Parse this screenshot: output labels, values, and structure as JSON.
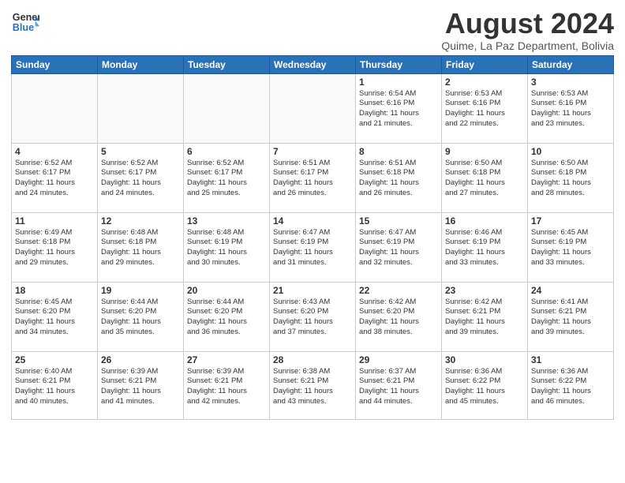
{
  "header": {
    "logo_general": "General",
    "logo_blue": "Blue",
    "month_title": "August 2024",
    "subtitle": "Quime, La Paz Department, Bolivia"
  },
  "days_of_week": [
    "Sunday",
    "Monday",
    "Tuesday",
    "Wednesday",
    "Thursday",
    "Friday",
    "Saturday"
  ],
  "weeks": [
    [
      {
        "num": "",
        "info": ""
      },
      {
        "num": "",
        "info": ""
      },
      {
        "num": "",
        "info": ""
      },
      {
        "num": "",
        "info": ""
      },
      {
        "num": "1",
        "info": "Sunrise: 6:54 AM\nSunset: 6:16 PM\nDaylight: 11 hours\nand 21 minutes."
      },
      {
        "num": "2",
        "info": "Sunrise: 6:53 AM\nSunset: 6:16 PM\nDaylight: 11 hours\nand 22 minutes."
      },
      {
        "num": "3",
        "info": "Sunrise: 6:53 AM\nSunset: 6:16 PM\nDaylight: 11 hours\nand 23 minutes."
      }
    ],
    [
      {
        "num": "4",
        "info": "Sunrise: 6:52 AM\nSunset: 6:17 PM\nDaylight: 11 hours\nand 24 minutes."
      },
      {
        "num": "5",
        "info": "Sunrise: 6:52 AM\nSunset: 6:17 PM\nDaylight: 11 hours\nand 24 minutes."
      },
      {
        "num": "6",
        "info": "Sunrise: 6:52 AM\nSunset: 6:17 PM\nDaylight: 11 hours\nand 25 minutes."
      },
      {
        "num": "7",
        "info": "Sunrise: 6:51 AM\nSunset: 6:17 PM\nDaylight: 11 hours\nand 26 minutes."
      },
      {
        "num": "8",
        "info": "Sunrise: 6:51 AM\nSunset: 6:18 PM\nDaylight: 11 hours\nand 26 minutes."
      },
      {
        "num": "9",
        "info": "Sunrise: 6:50 AM\nSunset: 6:18 PM\nDaylight: 11 hours\nand 27 minutes."
      },
      {
        "num": "10",
        "info": "Sunrise: 6:50 AM\nSunset: 6:18 PM\nDaylight: 11 hours\nand 28 minutes."
      }
    ],
    [
      {
        "num": "11",
        "info": "Sunrise: 6:49 AM\nSunset: 6:18 PM\nDaylight: 11 hours\nand 29 minutes."
      },
      {
        "num": "12",
        "info": "Sunrise: 6:48 AM\nSunset: 6:18 PM\nDaylight: 11 hours\nand 29 minutes."
      },
      {
        "num": "13",
        "info": "Sunrise: 6:48 AM\nSunset: 6:19 PM\nDaylight: 11 hours\nand 30 minutes."
      },
      {
        "num": "14",
        "info": "Sunrise: 6:47 AM\nSunset: 6:19 PM\nDaylight: 11 hours\nand 31 minutes."
      },
      {
        "num": "15",
        "info": "Sunrise: 6:47 AM\nSunset: 6:19 PM\nDaylight: 11 hours\nand 32 minutes."
      },
      {
        "num": "16",
        "info": "Sunrise: 6:46 AM\nSunset: 6:19 PM\nDaylight: 11 hours\nand 33 minutes."
      },
      {
        "num": "17",
        "info": "Sunrise: 6:45 AM\nSunset: 6:19 PM\nDaylight: 11 hours\nand 33 minutes."
      }
    ],
    [
      {
        "num": "18",
        "info": "Sunrise: 6:45 AM\nSunset: 6:20 PM\nDaylight: 11 hours\nand 34 minutes."
      },
      {
        "num": "19",
        "info": "Sunrise: 6:44 AM\nSunset: 6:20 PM\nDaylight: 11 hours\nand 35 minutes."
      },
      {
        "num": "20",
        "info": "Sunrise: 6:44 AM\nSunset: 6:20 PM\nDaylight: 11 hours\nand 36 minutes."
      },
      {
        "num": "21",
        "info": "Sunrise: 6:43 AM\nSunset: 6:20 PM\nDaylight: 11 hours\nand 37 minutes."
      },
      {
        "num": "22",
        "info": "Sunrise: 6:42 AM\nSunset: 6:20 PM\nDaylight: 11 hours\nand 38 minutes."
      },
      {
        "num": "23",
        "info": "Sunrise: 6:42 AM\nSunset: 6:21 PM\nDaylight: 11 hours\nand 39 minutes."
      },
      {
        "num": "24",
        "info": "Sunrise: 6:41 AM\nSunset: 6:21 PM\nDaylight: 11 hours\nand 39 minutes."
      }
    ],
    [
      {
        "num": "25",
        "info": "Sunrise: 6:40 AM\nSunset: 6:21 PM\nDaylight: 11 hours\nand 40 minutes."
      },
      {
        "num": "26",
        "info": "Sunrise: 6:39 AM\nSunset: 6:21 PM\nDaylight: 11 hours\nand 41 minutes."
      },
      {
        "num": "27",
        "info": "Sunrise: 6:39 AM\nSunset: 6:21 PM\nDaylight: 11 hours\nand 42 minutes."
      },
      {
        "num": "28",
        "info": "Sunrise: 6:38 AM\nSunset: 6:21 PM\nDaylight: 11 hours\nand 43 minutes."
      },
      {
        "num": "29",
        "info": "Sunrise: 6:37 AM\nSunset: 6:21 PM\nDaylight: 11 hours\nand 44 minutes."
      },
      {
        "num": "30",
        "info": "Sunrise: 6:36 AM\nSunset: 6:22 PM\nDaylight: 11 hours\nand 45 minutes."
      },
      {
        "num": "31",
        "info": "Sunrise: 6:36 AM\nSunset: 6:22 PM\nDaylight: 11 hours\nand 46 minutes."
      }
    ]
  ]
}
